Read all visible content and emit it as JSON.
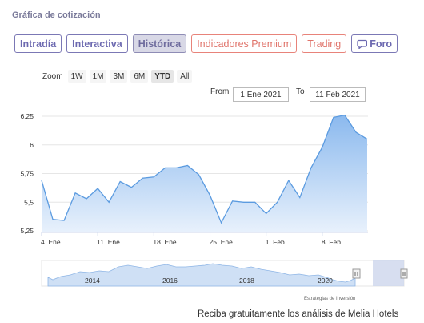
{
  "section_title": "Gráfica de cotización",
  "tabs": [
    {
      "label": "Intradía",
      "style": "normal"
    },
    {
      "label": "Interactiva",
      "style": "normal"
    },
    {
      "label": "Histórica",
      "style": "active"
    },
    {
      "label": "Indicadores Premium",
      "style": "premium"
    },
    {
      "label": "Trading",
      "style": "premium"
    },
    {
      "label": "Foro",
      "style": "normal",
      "icon": "chat-icon"
    }
  ],
  "zoom": {
    "label": "Zoom",
    "options": [
      "1W",
      "1M",
      "3M",
      "6M",
      "YTD",
      "All"
    ],
    "selected": "YTD"
  },
  "range": {
    "from_label": "From",
    "from_value": "1 Ene 2021",
    "to_label": "To",
    "to_value": "11 Feb 2021"
  },
  "navigator": {
    "years": [
      "2014",
      "2016",
      "2018",
      "2020"
    ],
    "credit": "Estrategias de Inversión"
  },
  "promo_text": "Reciba gratuitamente los análisis de Melia Hotels",
  "colors": {
    "line": "#5b9be0",
    "area_top": "#8bb9ee",
    "area_bottom": "#e8f1fc",
    "navigator_mask": "#cdd6ec"
  },
  "chart_data": {
    "type": "area",
    "title": "",
    "xlabel": "",
    "ylabel": "",
    "ylim": [
      5.25,
      6.25
    ],
    "yticks": [
      "5,25",
      "5,5",
      "5,75",
      "6",
      "6,25"
    ],
    "xticks": [
      "4. Ene",
      "11. Ene",
      "18. Ene",
      "25. Ene",
      "1. Feb",
      "8. Feb"
    ],
    "grid": true,
    "legend": "none",
    "series": [
      {
        "values": [
          5.69,
          5.35,
          5.34,
          5.58,
          5.53,
          5.62,
          5.5,
          5.68,
          5.63,
          5.71,
          5.72,
          5.8,
          5.8,
          5.82,
          5.74,
          5.56,
          5.32,
          5.51,
          5.5,
          5.5,
          5.4,
          5.5,
          5.69,
          5.54,
          5.8,
          5.98,
          6.24,
          6.26,
          6.11,
          6.05
        ]
      }
    ]
  }
}
